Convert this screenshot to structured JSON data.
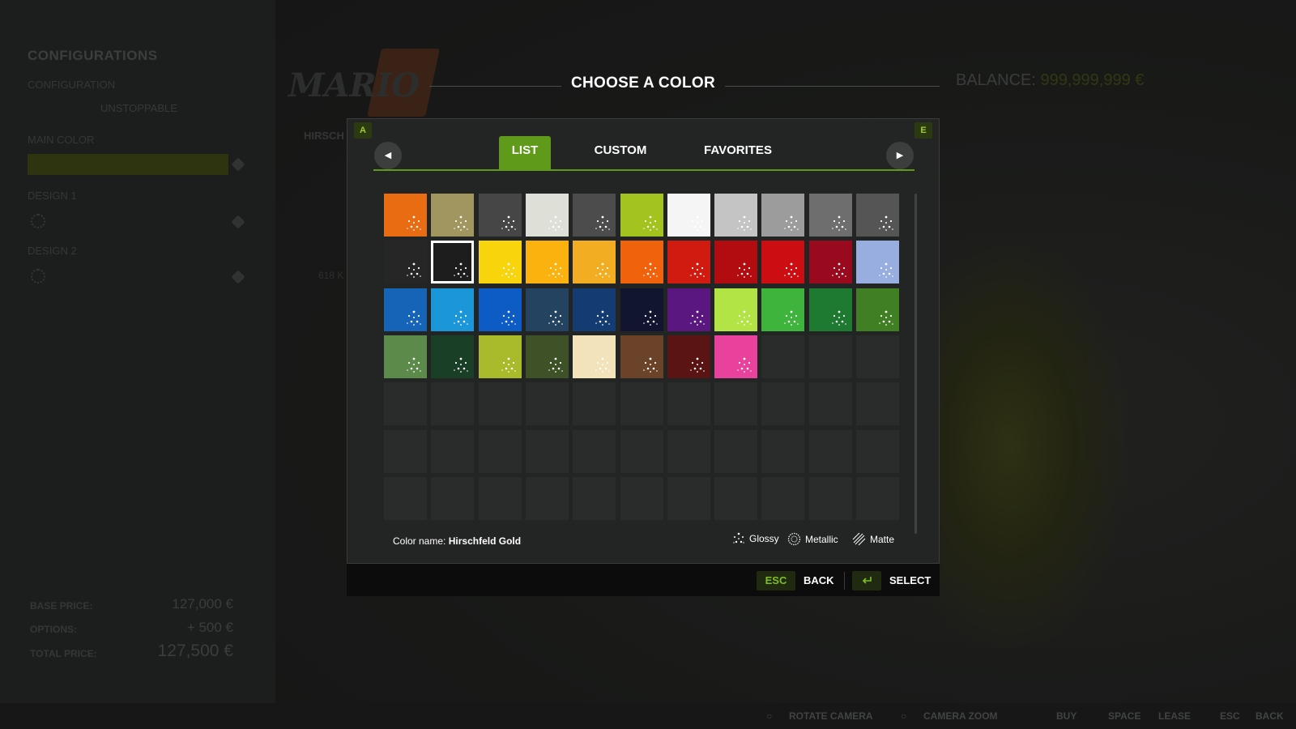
{
  "sidebar": {
    "title": "CONFIGURATIONS",
    "configuration_label": "CONFIGURATION",
    "configuration_value": "UNSTOPPABLE",
    "main_color_label": "MAIN COLOR",
    "design1_label": "DESIGN 1",
    "design2_label": "DESIGN 2",
    "base_price_label": "BASE PRICE:",
    "base_price": "127,000 €",
    "options_label": "OPTIONS:",
    "options_price": "+ 500 €",
    "total_label": "TOTAL PRICE:",
    "total_price": "127,500 €"
  },
  "background": {
    "brand": "MARIO",
    "brand_sub": "HIRSCH",
    "partial_value": "618 K",
    "balance_label": "BALANCE:",
    "balance_amount": "999,999,999 €"
  },
  "dialog": {
    "title": "CHOOSE A COLOR",
    "left_key": "A",
    "right_key": "E",
    "tabs": [
      "LIST",
      "CUSTOM",
      "FAVORITES"
    ],
    "active_tab": 0,
    "color_name_label": "Color name:",
    "color_name_value": "Hirschfeld Gold",
    "legend": [
      "Glossy",
      "Metallic",
      "Matte"
    ],
    "selected_index": 12,
    "swatches": [
      "#e96b12",
      "#a19660",
      "#464646",
      "#dedfd6",
      "#4c4c4c",
      "#a3c31e",
      "#f5f5f5",
      "#c4c4c4",
      "#9c9c9c",
      "#6e6e6e",
      "#555555",
      "#262626",
      "#1d1d1d",
      "#f7d40c",
      "#fbb20e",
      "#f3ad23",
      "#f1620c",
      "#d11a10",
      "#b20c10",
      "#cc0e12",
      "#9a0a1e",
      "#99aee0",
      "#1664b8",
      "#1a96d9",
      "#0d5bc4",
      "#244360",
      "#153c72",
      "#111530",
      "#5b1780",
      "#b3e445",
      "#3fb43d",
      "#1e7a30",
      "#417f24",
      "#5b8a4b",
      "#1a3f27",
      "#a9bb2a",
      "#3e5127",
      "#f2e3bb",
      "#6b4329",
      "#5a1414",
      "#e9429c"
    ]
  },
  "footer": {
    "esc_key": "ESC",
    "back_label": "BACK",
    "enter_icon": "enter-icon",
    "select_label": "SELECT"
  },
  "hints": {
    "rotate_camera": "ROTATE CAMERA",
    "camera_zoom": "CAMERA ZOOM",
    "buy": "BUY",
    "space_key": "SPACE",
    "lease": "LEASE",
    "esc_key": "ESC",
    "back": "BACK"
  }
}
